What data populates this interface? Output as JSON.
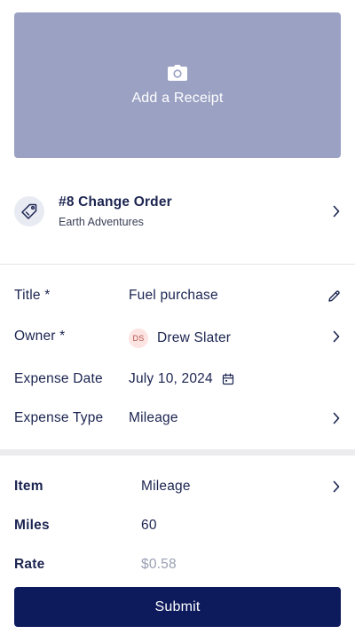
{
  "receipt": {
    "label": "Add a Receipt",
    "icon": "camera-icon"
  },
  "order": {
    "title": "#8 Change Order",
    "subtitle": "Earth Adventures",
    "icon": "tag-icon"
  },
  "fields": {
    "title": {
      "label": "Title *",
      "value": "Fuel purchase"
    },
    "owner": {
      "label": "Owner *",
      "initials": "DS",
      "value": "Drew Slater"
    },
    "expense_date": {
      "label": "Expense Date",
      "value": "July 10, 2024"
    },
    "expense_type": {
      "label": "Expense Type",
      "value": "Mileage"
    }
  },
  "item": {
    "item": {
      "label": "Item",
      "value": "Mileage"
    },
    "miles": {
      "label": "Miles",
      "value": "60"
    },
    "rate": {
      "label": "Rate",
      "value": "$0.58"
    }
  },
  "submit": {
    "label": "Submit"
  },
  "colors": {
    "primary": "#0d1a5c",
    "receipt_bg": "#9aa1c3",
    "text": "#1b2450",
    "muted": "#9aa0b2"
  }
}
